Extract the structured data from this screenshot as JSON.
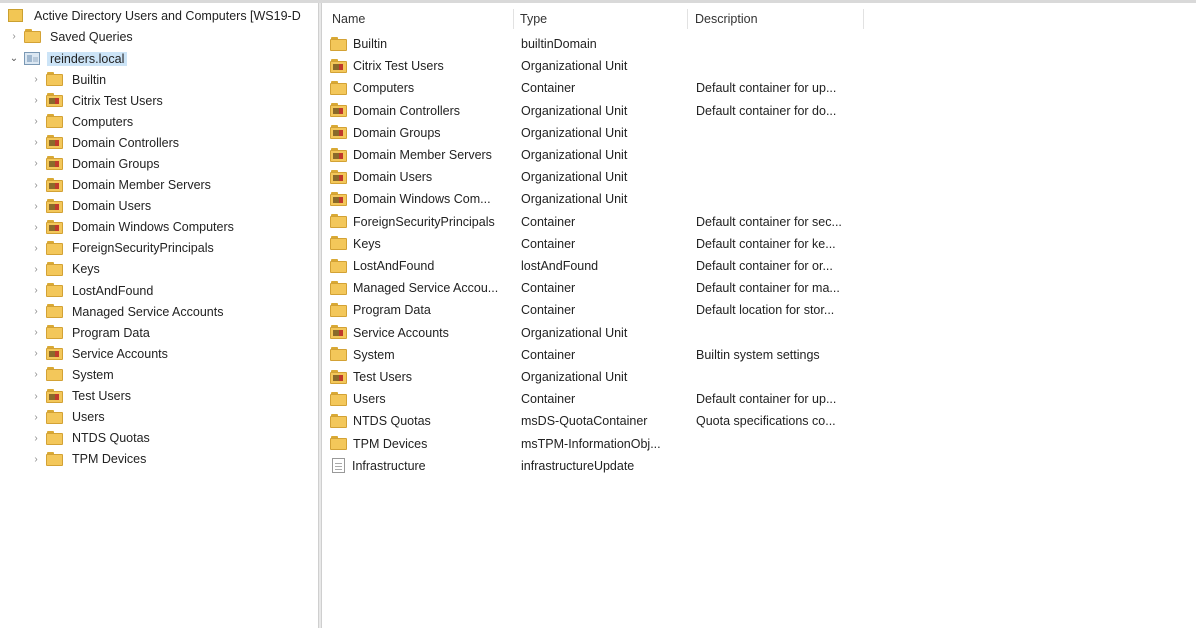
{
  "tree": {
    "root": {
      "label": "Active Directory Users and Computers [WS19-D",
      "icon": "aduc-app-icon"
    },
    "saved_queries": {
      "label": "Saved Queries",
      "icon": "folder-icon"
    },
    "domain": {
      "label": "reinders.local",
      "icon": "domain-icon",
      "selected": true
    },
    "children": [
      {
        "label": "Builtin",
        "icon": "folder-icon"
      },
      {
        "label": "Citrix Test Users",
        "icon": "ou-icon"
      },
      {
        "label": "Computers",
        "icon": "folder-icon"
      },
      {
        "label": "Domain Controllers",
        "icon": "ou-icon"
      },
      {
        "label": "Domain Groups",
        "icon": "ou-icon"
      },
      {
        "label": "Domain Member Servers",
        "icon": "ou-icon"
      },
      {
        "label": "Domain Users",
        "icon": "ou-icon"
      },
      {
        "label": "Domain Windows Computers",
        "icon": "ou-icon"
      },
      {
        "label": "ForeignSecurityPrincipals",
        "icon": "folder-icon"
      },
      {
        "label": "Keys",
        "icon": "folder-icon"
      },
      {
        "label": "LostAndFound",
        "icon": "folder-icon"
      },
      {
        "label": "Managed Service Accounts",
        "icon": "folder-icon"
      },
      {
        "label": "Program Data",
        "icon": "folder-icon"
      },
      {
        "label": "Service Accounts",
        "icon": "ou-icon"
      },
      {
        "label": "System",
        "icon": "folder-icon"
      },
      {
        "label": "Test Users",
        "icon": "ou-icon"
      },
      {
        "label": "Users",
        "icon": "folder-icon"
      },
      {
        "label": "NTDS Quotas",
        "icon": "folder-icon"
      },
      {
        "label": "TPM Devices",
        "icon": "folder-icon"
      }
    ]
  },
  "list": {
    "columns": {
      "name": "Name",
      "type": "Type",
      "description": "Description"
    },
    "rows": [
      {
        "name": "Builtin",
        "type": "builtinDomain",
        "description": "",
        "icon": "folder-icon"
      },
      {
        "name": "Citrix Test Users",
        "type": "Organizational Unit",
        "description": "",
        "icon": "ou-icon"
      },
      {
        "name": "Computers",
        "type": "Container",
        "description": "Default container for up...",
        "icon": "folder-icon"
      },
      {
        "name": "Domain Controllers",
        "type": "Organizational Unit",
        "description": "Default container for do...",
        "icon": "ou-icon"
      },
      {
        "name": "Domain Groups",
        "type": "Organizational Unit",
        "description": "",
        "icon": "ou-icon"
      },
      {
        "name": "Domain Member Servers",
        "type": "Organizational Unit",
        "description": "",
        "icon": "ou-icon"
      },
      {
        "name": "Domain Users",
        "type": "Organizational Unit",
        "description": "",
        "icon": "ou-icon"
      },
      {
        "name": "Domain Windows Com...",
        "type": "Organizational Unit",
        "description": "",
        "icon": "ou-icon"
      },
      {
        "name": "ForeignSecurityPrincipals",
        "type": "Container",
        "description": "Default container for sec...",
        "icon": "folder-icon"
      },
      {
        "name": "Keys",
        "type": "Container",
        "description": "Default container for ke...",
        "icon": "folder-icon"
      },
      {
        "name": "LostAndFound",
        "type": "lostAndFound",
        "description": "Default container for or...",
        "icon": "folder-icon"
      },
      {
        "name": "Managed Service Accou...",
        "type": "Container",
        "description": "Default container for ma...",
        "icon": "folder-icon"
      },
      {
        "name": "Program Data",
        "type": "Container",
        "description": "Default location for stor...",
        "icon": "folder-icon"
      },
      {
        "name": "Service Accounts",
        "type": "Organizational Unit",
        "description": "",
        "icon": "ou-icon"
      },
      {
        "name": "System",
        "type": "Container",
        "description": "Builtin system settings",
        "icon": "folder-icon"
      },
      {
        "name": "Test Users",
        "type": "Organizational Unit",
        "description": "",
        "icon": "ou-icon"
      },
      {
        "name": "Users",
        "type": "Container",
        "description": "Default container for up...",
        "icon": "folder-icon"
      },
      {
        "name": "NTDS Quotas",
        "type": "msDS-QuotaContainer",
        "description": "Quota specifications co...",
        "icon": "folder-icon"
      },
      {
        "name": "TPM Devices",
        "type": "msTPM-InformationObj...",
        "description": "",
        "icon": "folder-icon"
      },
      {
        "name": "Infrastructure",
        "type": "infrastructureUpdate",
        "description": "",
        "icon": "document-icon"
      }
    ]
  }
}
